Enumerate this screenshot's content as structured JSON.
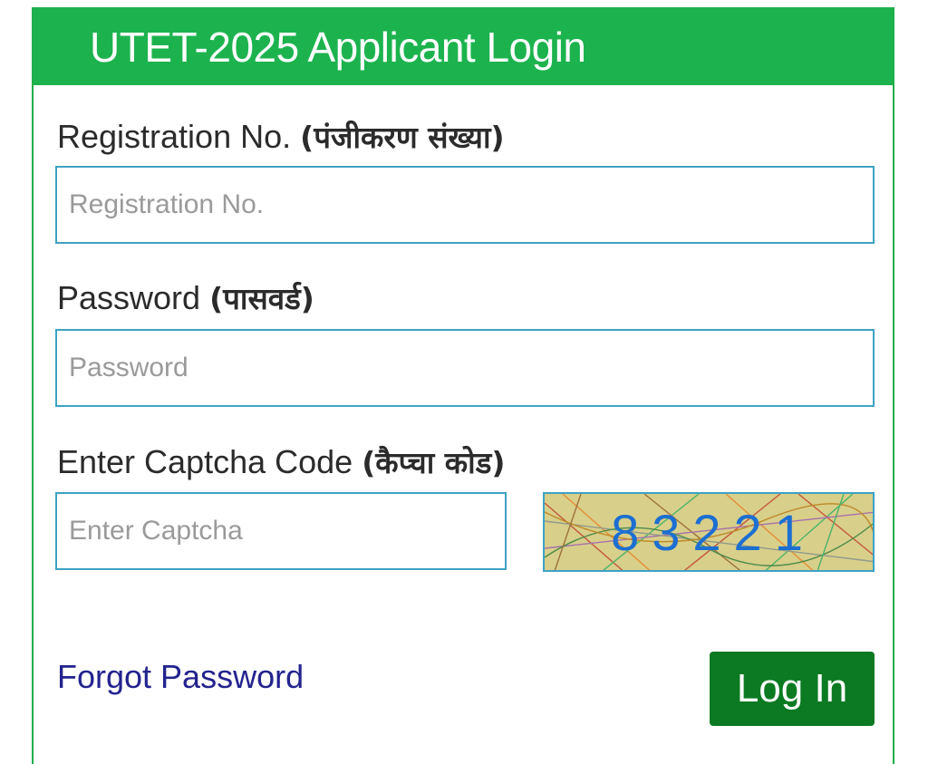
{
  "header": {
    "title": "UTET-2025 Applicant Login"
  },
  "form": {
    "registration": {
      "label": "Registration No.",
      "label_hi": "(पंजीकरण संख्या)",
      "placeholder": "Registration No.",
      "value": ""
    },
    "password": {
      "label": "Password",
      "label_hi": "(पासवर्ड)",
      "placeholder": "Password",
      "value": ""
    },
    "captcha": {
      "label": "Enter Captcha Code",
      "label_hi": "(कैप्चा कोड)",
      "placeholder": "Enter Captcha",
      "value": "",
      "code": "83221"
    }
  },
  "actions": {
    "forgot_label": "Forgot Password",
    "login_label": "Log In"
  },
  "colors": {
    "header_green": "#1cb34e",
    "button_green": "#0b7a22",
    "input_border": "#3ea2c4",
    "link_blue": "#23238e",
    "captcha_text": "#1c6fd1"
  }
}
